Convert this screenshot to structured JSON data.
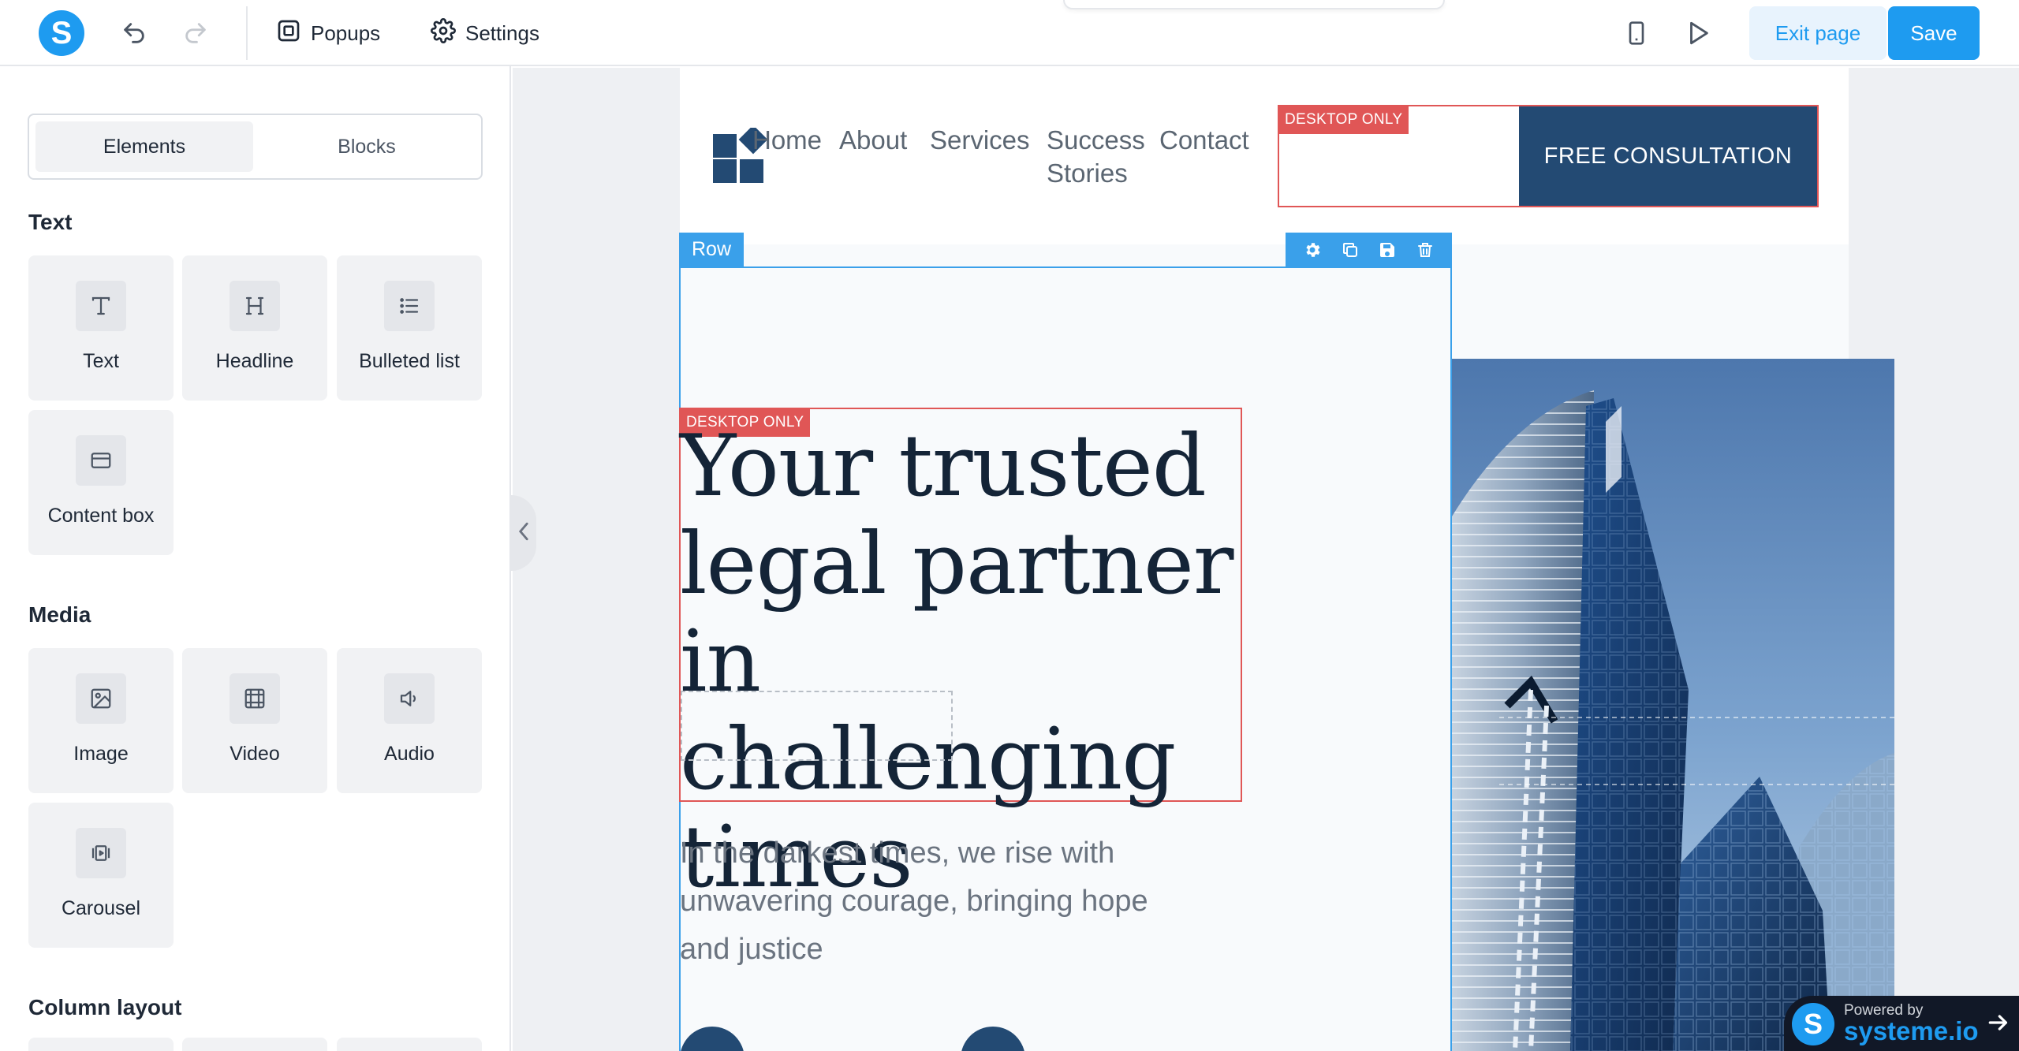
{
  "topbar": {
    "logo_letter": "S",
    "popups_label": "Popups",
    "settings_label": "Settings",
    "exit_label": "Exit page",
    "save_label": "Save"
  },
  "sidebar": {
    "tabs": [
      "Elements",
      "Blocks"
    ],
    "sections": [
      {
        "title": "Text",
        "items": [
          "Text",
          "Headline",
          "Bulleted list",
          "Content box"
        ]
      },
      {
        "title": "Media",
        "items": [
          "Image",
          "Video",
          "Audio",
          "Carousel"
        ]
      },
      {
        "title": "Column layout",
        "items": []
      }
    ]
  },
  "page": {
    "nav": [
      "Home",
      "About",
      "Services",
      "Success",
      "Stories",
      "Contact"
    ],
    "cta_label": "FREE CONSULTATION",
    "desktop_only_badge": "DESKTOP ONLY",
    "row_label": "Row",
    "headline_lines": [
      "Your trusted",
      "legal partner",
      "in challenging",
      "times"
    ],
    "subtext_lines": [
      "In the darkest times, we rise with",
      "unwavering courage, bringing hope",
      "and justice"
    ]
  },
  "powered": {
    "logo_letter": "S",
    "by": "Powered by",
    "name": "systeme.io"
  },
  "colors": {
    "accent": "#1e9bf0",
    "brand_navy": "#234a73",
    "desktop_only_red": "#e05656",
    "row_blue": "#3aa0ea"
  }
}
